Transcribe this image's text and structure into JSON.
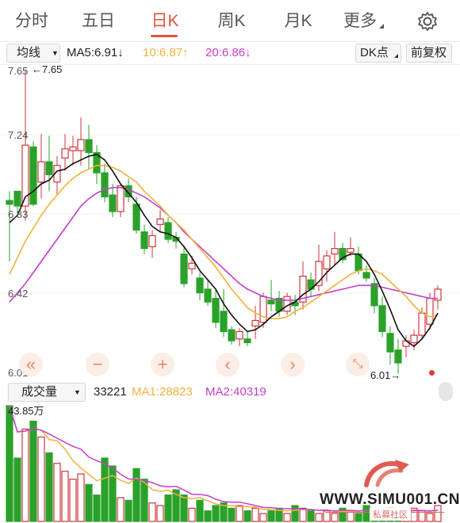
{
  "tabs": [
    {
      "label": "分时"
    },
    {
      "label": "五日"
    },
    {
      "label": "日K"
    },
    {
      "label": "周K"
    },
    {
      "label": "月K"
    },
    {
      "label": "更多"
    }
  ],
  "active_tab": "日K",
  "indicator_bar": {
    "selector": "均线",
    "ma5": "MA5:6.91↓",
    "ma10": "10:6.87↑",
    "ma20": "20:6.86↓",
    "dk_button": "DK点",
    "adjust_button": "前复权"
  },
  "price_axis": {
    "labels": [
      "7.65",
      "7.24",
      "6.83",
      "6.42",
      "6.01"
    ],
    "high_label": "←7.65",
    "low_label": "6.01→"
  },
  "volume_bar": {
    "selector": "成交量",
    "vol": "33221",
    "ma1": "MA1:28823",
    "ma2": "MA2:40319",
    "max_label": "43.85万"
  },
  "watermark": {
    "text": "WWW.SIMU001.CN",
    "sub": "私募社区"
  },
  "colors": {
    "up": "#d0343a",
    "down": "#2aa22a",
    "ma5": "#111111",
    "ma10": "#f0b23c",
    "ma20": "#c43fcb",
    "accent": "#e1533c"
  },
  "chart_data": {
    "type": "candlestick",
    "ylim": [
      6.01,
      7.65
    ],
    "candles": [
      [
        6.95,
        7.0,
        6.62,
        6.93
      ],
      [
        7.0,
        6.99,
        6.88,
        6.92
      ],
      [
        6.92,
        7.66,
        6.84,
        7.25
      ],
      [
        7.24,
        7.27,
        6.92,
        6.93
      ],
      [
        7.05,
        7.31,
        6.96,
        7.16
      ],
      [
        7.16,
        7.3,
        7.0,
        7.09
      ],
      [
        7.05,
        7.19,
        6.98,
        7.14
      ],
      [
        7.18,
        7.31,
        7.11,
        7.23
      ],
      [
        7.22,
        7.3,
        7.14,
        7.24
      ],
      [
        7.22,
        7.4,
        7.14,
        7.28
      ],
      [
        7.28,
        7.36,
        7.12,
        7.21
      ],
      [
        7.21,
        7.25,
        7.04,
        7.1
      ],
      [
        7.1,
        7.15,
        6.94,
        6.97
      ],
      [
        6.98,
        7.04,
        6.86,
        6.89
      ],
      [
        6.89,
        7.04,
        6.86,
        7.03
      ],
      [
        7.03,
        7.07,
        6.94,
        6.97
      ],
      [
        6.93,
        6.97,
        6.77,
        6.79
      ],
      [
        6.78,
        6.82,
        6.66,
        6.69
      ],
      [
        6.7,
        6.79,
        6.64,
        6.76
      ],
      [
        6.82,
        6.9,
        6.78,
        6.85
      ],
      [
        6.83,
        6.86,
        6.72,
        6.74
      ],
      [
        6.75,
        6.78,
        6.69,
        6.73
      ],
      [
        6.66,
        6.7,
        6.48,
        6.5
      ],
      [
        6.58,
        6.65,
        6.55,
        6.61
      ],
      [
        6.53,
        6.56,
        6.41,
        6.45
      ],
      [
        6.47,
        6.52,
        6.38,
        6.4
      ],
      [
        6.42,
        6.47,
        6.26,
        6.29
      ],
      [
        6.35,
        6.47,
        6.21,
        6.24
      ],
      [
        6.25,
        6.27,
        6.17,
        6.19
      ],
      [
        6.2,
        6.26,
        6.16,
        6.24
      ],
      [
        6.2,
        6.24,
        6.16,
        6.18
      ],
      [
        6.27,
        6.38,
        6.2,
        6.3
      ],
      [
        6.29,
        6.45,
        6.26,
        6.43
      ],
      [
        6.41,
        6.52,
        6.35,
        6.39
      ],
      [
        6.42,
        6.46,
        6.32,
        6.35
      ],
      [
        6.35,
        6.45,
        6.33,
        6.43
      ],
      [
        6.4,
        6.44,
        6.33,
        6.38
      ],
      [
        6.4,
        6.62,
        6.36,
        6.54
      ],
      [
        6.52,
        6.56,
        6.43,
        6.47
      ],
      [
        6.49,
        6.71,
        6.46,
        6.62
      ],
      [
        6.58,
        6.68,
        6.51,
        6.65
      ],
      [
        6.66,
        6.78,
        6.6,
        6.69
      ],
      [
        6.69,
        6.72,
        6.61,
        6.63
      ],
      [
        6.67,
        6.75,
        6.65,
        6.69
      ],
      [
        6.66,
        6.7,
        6.55,
        6.57
      ],
      [
        6.56,
        6.6,
        6.51,
        6.53
      ],
      [
        6.5,
        6.53,
        6.34,
        6.38
      ],
      [
        6.38,
        6.43,
        6.21,
        6.24
      ],
      [
        6.23,
        6.27,
        6.06,
        6.13
      ],
      [
        6.14,
        6.2,
        6.01,
        6.07
      ],
      [
        6.16,
        6.22,
        6.1,
        6.19
      ],
      [
        6.18,
        6.25,
        6.14,
        6.22
      ],
      [
        6.22,
        6.37,
        6.2,
        6.34
      ],
      [
        6.28,
        6.45,
        6.25,
        6.42
      ],
      [
        6.41,
        6.49,
        6.36,
        6.47
      ]
    ],
    "ma5": [
      6.83,
      6.87,
      6.97,
      7.0,
      7.04,
      7.06,
      7.11,
      7.12,
      7.15,
      7.17,
      7.19,
      7.2,
      7.17,
      7.11,
      7.04,
      6.99,
      6.94,
      6.87,
      6.81,
      6.78,
      6.77,
      6.75,
      6.7,
      6.64,
      6.57,
      6.52,
      6.47,
      6.39,
      6.33,
      6.28,
      6.24,
      6.25,
      6.28,
      6.32,
      6.35,
      6.38,
      6.4,
      6.44,
      6.47,
      6.51,
      6.56,
      6.6,
      6.64,
      6.66,
      6.66,
      6.62,
      6.55,
      6.46,
      6.36,
      6.25,
      6.19,
      6.16,
      6.2,
      6.26,
      6.34
    ],
    "ma10": [
      6.55,
      6.64,
      6.73,
      6.8,
      6.87,
      6.93,
      6.98,
      7.03,
      7.07,
      7.1,
      7.12,
      7.14,
      7.14,
      7.13,
      7.11,
      7.08,
      7.05,
      7.0,
      6.96,
      6.92,
      6.87,
      6.83,
      6.79,
      6.74,
      6.69,
      6.64,
      6.59,
      6.53,
      6.47,
      6.42,
      6.37,
      6.34,
      6.32,
      6.31,
      6.31,
      6.32,
      6.35,
      6.37,
      6.4,
      6.43,
      6.46,
      6.49,
      6.52,
      6.55,
      6.57,
      6.58,
      6.57,
      6.55,
      6.51,
      6.47,
      6.43,
      6.38,
      6.34,
      6.32,
      6.33
    ],
    "ma20": [
      6.4,
      6.45,
      6.5,
      6.56,
      6.62,
      6.68,
      6.74,
      6.8,
      6.86,
      6.92,
      6.96,
      6.99,
      7.01,
      7.02,
      7.02,
      7.01,
      6.99,
      6.97,
      6.94,
      6.91,
      6.87,
      6.83,
      6.78,
      6.74,
      6.7,
      6.66,
      6.62,
      6.58,
      6.54,
      6.5,
      6.47,
      6.45,
      6.43,
      6.42,
      6.41,
      6.41,
      6.41,
      6.42,
      6.43,
      6.44,
      6.45,
      6.46,
      6.47,
      6.48,
      6.49,
      6.49,
      6.49,
      6.48,
      6.47,
      6.46,
      6.45,
      6.44,
      6.43,
      6.42,
      6.42
    ],
    "volume": [
      43.85,
      24,
      35,
      38,
      32,
      26,
      22,
      19,
      16,
      18,
      14,
      10,
      24,
      21,
      9,
      8,
      20,
      16,
      7,
      6,
      10,
      12,
      10,
      5,
      8,
      4,
      6,
      7,
      5,
      6,
      4,
      5,
      3,
      4,
      5,
      3,
      6,
      5,
      4,
      3,
      4,
      3,
      5,
      4,
      3,
      6,
      4,
      3,
      5,
      4,
      3,
      5,
      4,
      3,
      6
    ],
    "vol_max": 43.85
  }
}
